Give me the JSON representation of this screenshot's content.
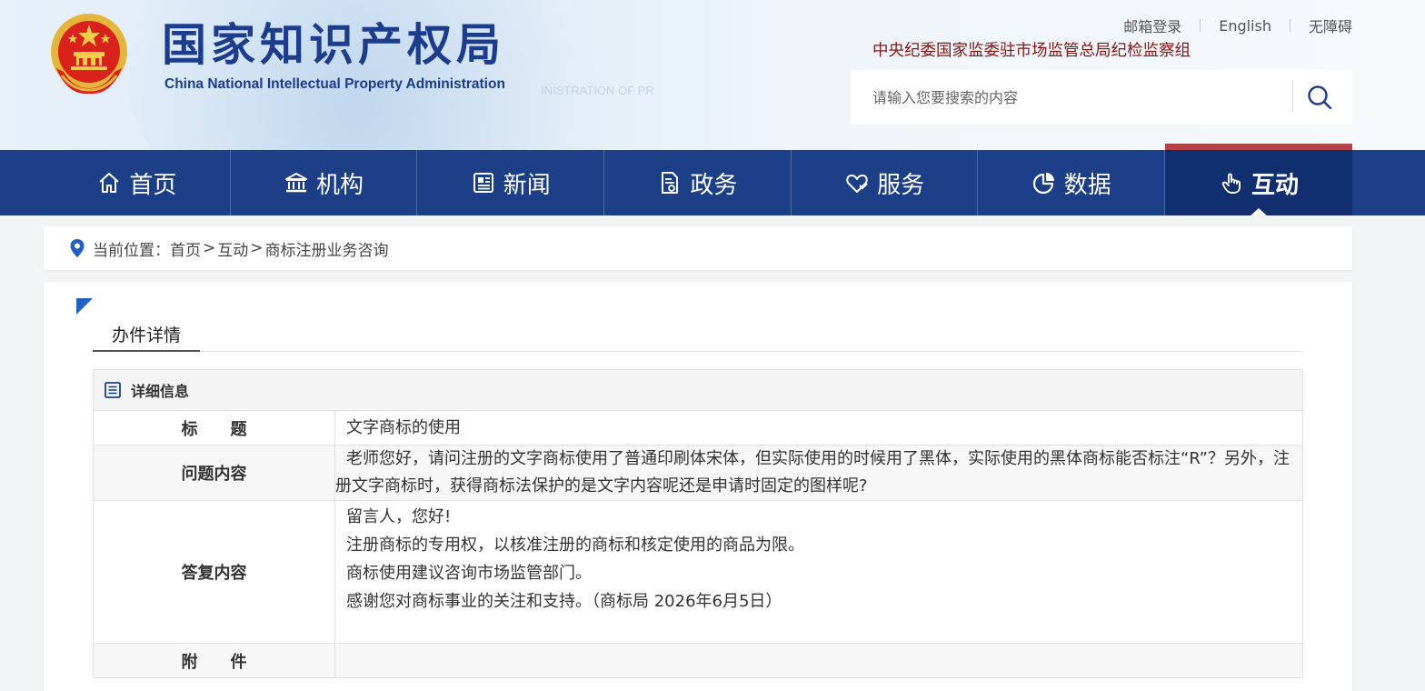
{
  "header": {
    "site_name_cn": "国家知识产权局",
    "site_name_en": "China National Intellectual Property Administration",
    "watermark_en": "INISTRATION OF PR",
    "top_links": [
      "邮箱登录",
      "English",
      "无障碍"
    ],
    "inspection_group": "中央纪委国家监委驻市场监管总局纪检监察组",
    "search": {
      "placeholder": "请输入您要搜索的内容"
    }
  },
  "nav": {
    "items": [
      {
        "label": "首页",
        "icon": "home-icon"
      },
      {
        "label": "机构",
        "icon": "institution-icon"
      },
      {
        "label": "新闻",
        "icon": "newspaper-icon"
      },
      {
        "label": "政务",
        "icon": "document-icon"
      },
      {
        "label": "服务",
        "icon": "heart-hand-icon"
      },
      {
        "label": "数据",
        "icon": "pie-chart-icon"
      },
      {
        "label": "互动",
        "icon": "tap-hand-icon"
      }
    ],
    "active_index": 6
  },
  "breadcrumb": {
    "prefix": "当前位置：",
    "items": [
      "首页",
      "互动",
      "商标注册业务咨询"
    ],
    "separator": ">"
  },
  "tab": {
    "label": "办件详情"
  },
  "detail": {
    "header": "详细信息",
    "rows": {
      "title": {
        "label": "标　　题",
        "value": "文字商标的使用"
      },
      "question": {
        "label": "问题内容",
        "value": "老师您好，请问注册的文字商标使用了普通印刷体宋体，但实际使用的时候用了黑体，实际使用的黑体商标能否标注“R”？另外，注册文字商标时，获得商标法保护的是文字内容呢还是申请时固定的图样呢?"
      },
      "answer": {
        "label": "答复内容",
        "lines": [
          "留言人，您好!",
          "注册商标的专用权，以核准注册的商标和核定使用的商品为限。",
          "商标使用建议咨询市场监管部门。",
          "感谢您对商标事业的关注和支持。（商标局 2026年6月5日）"
        ]
      },
      "attachment": {
        "label": "附　　件",
        "value": ""
      }
    }
  },
  "colors": {
    "nav_bg": "#1c3f87",
    "nav_active_bg": "#112f6e",
    "nav_active_accent": "#b24446",
    "title_blue": "#1c3c8c",
    "inspection_red": "#8b1510",
    "corner_blue": "#1f62c2"
  }
}
